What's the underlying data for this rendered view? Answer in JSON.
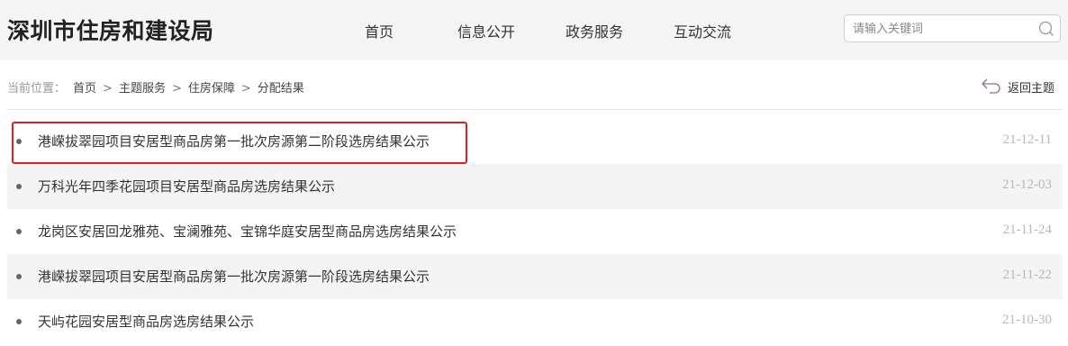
{
  "header": {
    "site_title": "深圳市住房和建设局",
    "nav": [
      "首页",
      "信息公开",
      "政务服务",
      "互动交流"
    ],
    "search": {
      "placeholder": "请输入关键词",
      "value": "",
      "icon": "search-icon"
    }
  },
  "breadcrumb": {
    "prefix": "当前位置：",
    "items": [
      "首页",
      "主题服务",
      "住房保障",
      "分配结果"
    ],
    "separator": ">",
    "back_label": "返回主题",
    "back_icon": "return-arrow-icon"
  },
  "list": {
    "items": [
      {
        "title": "港嵘拔翠园项目安居型商品房第一批次房源第二阶段选房结果公示",
        "date": "21-12-11",
        "highlighted": true
      },
      {
        "title": "万科光年四季花园项目安居型商品房选房结果公示",
        "date": "21-12-03",
        "highlighted": false
      },
      {
        "title": "龙岗区安居回龙雅苑、宝澜雅苑、宝锦华庭安居型商品房选房结果公示",
        "date": "21-11-24",
        "highlighted": false
      },
      {
        "title": "港嵘拔翠园项目安居型商品房第一批次房源第一阶段选房结果公示",
        "date": "21-11-22",
        "highlighted": false
      },
      {
        "title": "天屿花园安居型商品房选房结果公示",
        "date": "21-10-30",
        "highlighted": false
      }
    ]
  },
  "colors": {
    "highlight_border": "#e02020",
    "date_text": "#b8b8b8",
    "header_bg": "#f5f5f5",
    "alt_row_bg": "#f4f4f4"
  }
}
